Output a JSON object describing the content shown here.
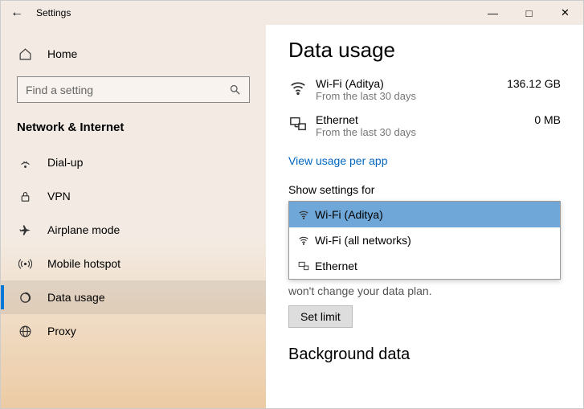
{
  "titlebar": {
    "title": "Settings"
  },
  "sidebar": {
    "home": "Home",
    "search_placeholder": "Find a setting",
    "section": "Network & Internet",
    "items": [
      {
        "label": "Dial-up"
      },
      {
        "label": "VPN"
      },
      {
        "label": "Airplane mode"
      },
      {
        "label": "Mobile hotspot"
      },
      {
        "label": "Data usage"
      },
      {
        "label": "Proxy"
      }
    ]
  },
  "main": {
    "title": "Data usage",
    "usage": [
      {
        "name": "Wi-Fi (Aditya)",
        "sub": "From the last 30 days",
        "value": "136.12 GB"
      },
      {
        "name": "Ethernet",
        "sub": "From the last 30 days",
        "value": "0 MB"
      }
    ],
    "link": "View usage per app",
    "show_label": "Show settings for",
    "options": [
      {
        "label": "Wi-Fi (Aditya)"
      },
      {
        "label": "Wi-Fi (all networks)"
      },
      {
        "label": "Ethernet"
      }
    ],
    "below": "won't change your data plan.",
    "button": "Set limit",
    "subhead": "Background data"
  }
}
